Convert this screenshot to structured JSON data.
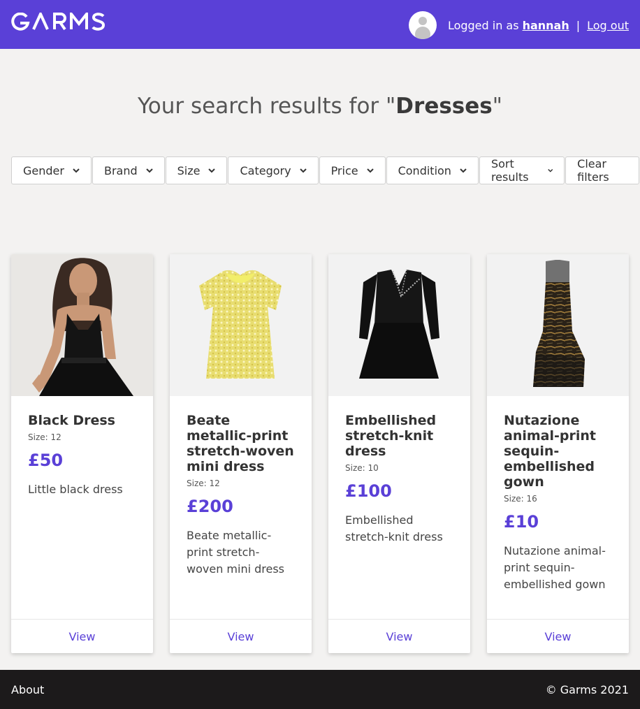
{
  "header": {
    "logo_text": "GARMS",
    "logged_in_prefix": "Logged in as",
    "username": "hannah",
    "separator": "|",
    "logout_label": "Log out",
    "brand_color": "#5a40d7"
  },
  "search": {
    "prefix": "Your search results for \"",
    "query": "Dresses",
    "suffix": "\""
  },
  "filters": [
    {
      "label": "Gender"
    },
    {
      "label": "Brand"
    },
    {
      "label": "Size"
    },
    {
      "label": "Category"
    },
    {
      "label": "Price"
    },
    {
      "label": "Condition"
    },
    {
      "label": "Sort results"
    }
  ],
  "clear_filters_label": "Clear filters",
  "products": [
    {
      "title": "Black Dress",
      "size": "Size: 12",
      "price": "£50",
      "description": "Little black dress",
      "view_label": "View"
    },
    {
      "title": "Beate metallic-print stretch-woven mini dress",
      "size": "Size: 12",
      "price": "£200",
      "description": "Beate metallic-print stretch-woven mini dress",
      "view_label": "View"
    },
    {
      "title": "Embellished stretch-knit dress",
      "size": "Size: 10",
      "price": "£100",
      "description": "Embellished stretch-knit dress",
      "view_label": "View"
    },
    {
      "title": "Nutazione animal-print sequin-embellished gown",
      "size": "Size: 16",
      "price": "£10",
      "description": "Nutazione animal-print sequin-embellished gown",
      "view_label": "View"
    }
  ],
  "footer": {
    "about_label": "About",
    "copyright": "© Garms 2021"
  }
}
